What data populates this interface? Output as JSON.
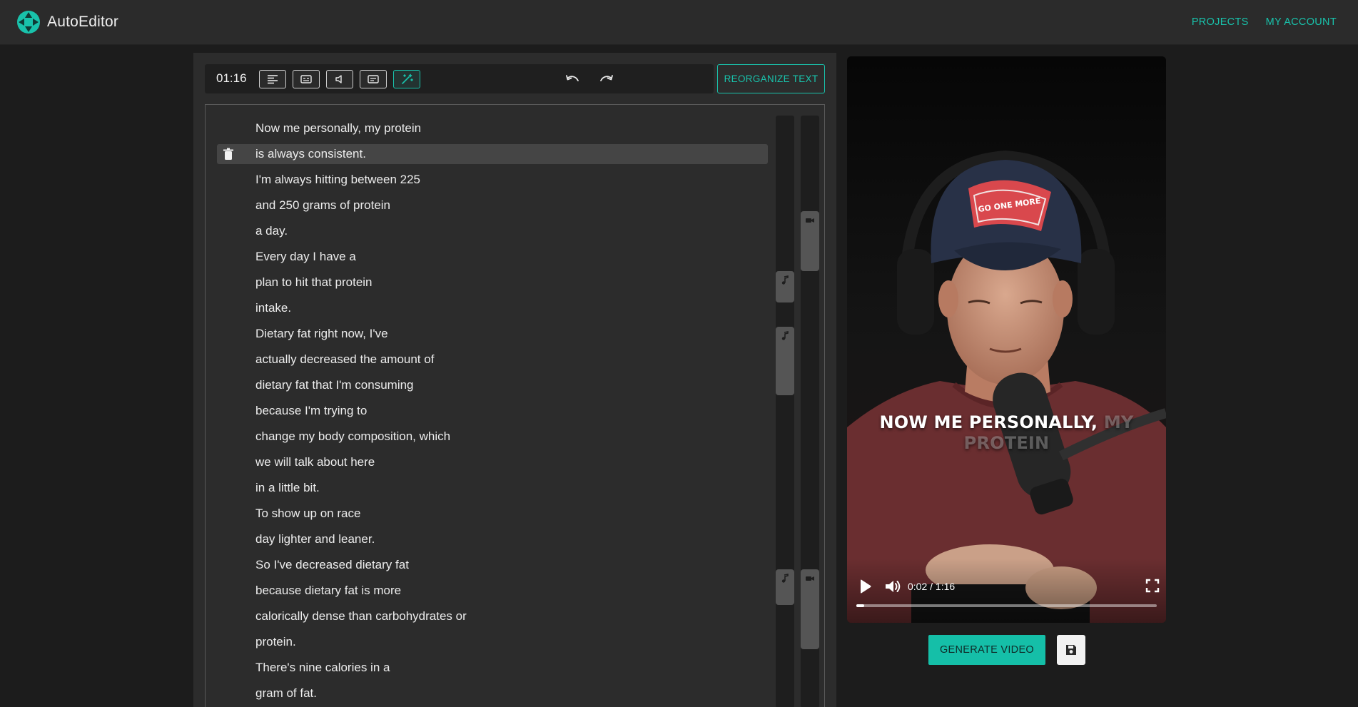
{
  "app": {
    "name": "AutoEditor"
  },
  "nav": {
    "projects": "PROJECTS",
    "account": "MY ACCOUNT"
  },
  "toolbar": {
    "duration": "01:16",
    "tools": [
      {
        "name": "text-align-icon"
      },
      {
        "name": "subtitles-icon"
      },
      {
        "name": "speaker-icon"
      },
      {
        "name": "captions-icon"
      },
      {
        "name": "magic-wand-icon",
        "active": true
      }
    ],
    "reorganize_label": "REORGANIZE TEXT"
  },
  "transcript": {
    "lines": [
      "Now me personally, my protein",
      "is always consistent.",
      "I'm always hitting between 225",
      "and 250 grams of protein",
      "a day.",
      "Every day I have a",
      "plan to hit that protein",
      "intake.",
      "Dietary fat right now, I've",
      "actually decreased the amount of",
      "dietary fat that I'm consuming",
      "because I'm trying to",
      "change my body composition, which",
      "we will talk about here",
      "in a little bit.",
      "To show up on race",
      "day lighter and leaner.",
      "So I've decreased dietary fat",
      "because dietary fat is more",
      "calorically dense than carbohydrates or",
      "protein.",
      "There's nine calories in a",
      "gram of fat."
    ],
    "selected_index": 1
  },
  "video": {
    "caption_active": "NOW ME PERSONALLY,",
    "caption_upcoming_1": "MY",
    "caption_upcoming_2": "PROTEIN",
    "hat_text": "GO ONE MORE",
    "timecode": "0:02 / 1:16",
    "progress_fraction": 0.027
  },
  "actions": {
    "generate_label": "GENERATE VIDEO"
  },
  "colors": {
    "accent": "#19c2ab",
    "background": "#1c1c1c",
    "panel": "#2c2c2c",
    "topbar": "#2b2b2b"
  }
}
